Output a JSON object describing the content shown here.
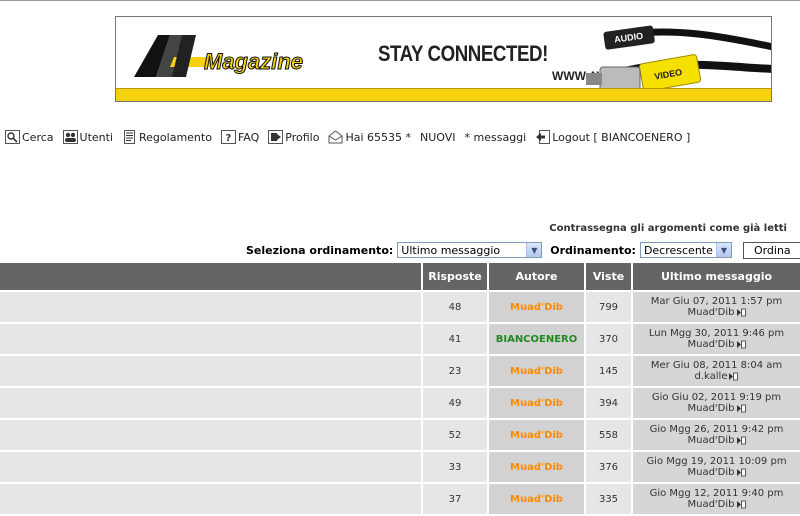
{
  "banner": {
    "logo_text": "Magazine",
    "slogan": "STAY CONNECTED!",
    "url": "WWW.AV",
    "cable_labels": [
      "AUDIO",
      "VIDEO"
    ]
  },
  "nav": {
    "search": "Cerca",
    "users": "Utenti",
    "rules": "Regolamento",
    "faq": "FAQ",
    "profile": "Profilo",
    "messages": "Hai 65535 *",
    "new": "NUOVI",
    "messages_suffix": "* messaggi",
    "logout": "Logout [ BIANCOENERO ]"
  },
  "controls": {
    "mark_read": "Contrassegna gli argomenti come già letti",
    "sort_label": "Seleziona ordinamento:",
    "sort_value": "Ultimo messaggio",
    "order_label": "Ordinamento:",
    "order_value": "Decrescente",
    "order_button": "Ordina"
  },
  "table": {
    "headers": {
      "replies": "Risposte",
      "author": "Autore",
      "views": "Viste",
      "last": "Ultimo messaggio"
    },
    "rows": [
      {
        "replies": "48",
        "author": "Muad'Dib",
        "author_color": "orange",
        "views": "799",
        "last_date": "Mar Giu 07, 2011 1:57 pm",
        "last_user": "Muad'Dib"
      },
      {
        "replies": "41",
        "author": "BIANCOENERO",
        "author_color": "green",
        "views": "370",
        "last_date": "Lun Mgg 30, 2011 9:46 pm",
        "last_user": "Muad'Dib"
      },
      {
        "replies": "23",
        "author": "Muad'Dib",
        "author_color": "orange",
        "views": "145",
        "last_date": "Mer Giu 08, 2011 8:04 am",
        "last_user": "d.kalle"
      },
      {
        "replies": "49",
        "author": "Muad'Dib",
        "author_color": "orange",
        "views": "394",
        "last_date": "Gio Giu 02, 2011 9:19 pm",
        "last_user": "Muad'Dib"
      },
      {
        "replies": "52",
        "author": "Muad'Dib",
        "author_color": "orange",
        "views": "558",
        "last_date": "Gio Mgg 26, 2011 9:42 pm",
        "last_user": "Muad'Dib"
      },
      {
        "replies": "33",
        "author": "Muad'Dib",
        "author_color": "orange",
        "views": "376",
        "last_date": "Gio Mgg 19, 2011 10:09 pm",
        "last_user": "Muad'Dib"
      },
      {
        "replies": "37",
        "author": "Muad'Dib",
        "author_color": "orange",
        "views": "335",
        "last_date": "Gio Mgg 12, 2011 9:40 pm",
        "last_user": "Muad'Dib"
      }
    ]
  }
}
